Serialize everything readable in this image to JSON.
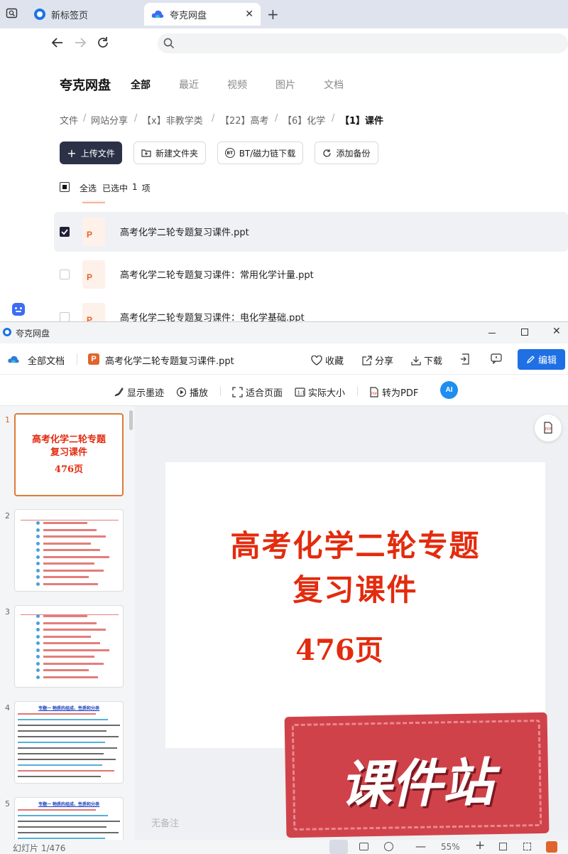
{
  "browser": {
    "tabs": [
      {
        "label": "新标签页"
      },
      {
        "label": "夸克网盘"
      }
    ]
  },
  "cloud": {
    "app_title": "夸克网盘",
    "menu": [
      "全部",
      "最近",
      "视频",
      "图片",
      "文档"
    ],
    "breadcrumb": [
      "文件",
      "网站分享",
      "【x】非教学类",
      "【22】高考",
      "【6】化学",
      "【1】课件"
    ],
    "buttons": {
      "upload": "上传文件",
      "new_folder": "新建文件夹",
      "bt": "BT/磁力链下载",
      "backup": "添加备份"
    },
    "select_all": "全选",
    "selected_text": "已选中",
    "selected_count": "1",
    "selected_unit": "项",
    "files": [
      {
        "name": "高考化学二轮专题复习课件.ppt",
        "checked": true
      },
      {
        "name": "高考化学二轮专题复习课件：常用化学计量.ppt",
        "checked": false
      },
      {
        "name": "高考化学二轮专题复习课件：电化学基础.ppt",
        "checked": false
      }
    ]
  },
  "viewer": {
    "window_title": "夸克网盘",
    "all_docs": "全部文档",
    "doc_title": "高考化学二轮专题复习课件.ppt",
    "actions": {
      "favorite": "收藏",
      "share": "分享",
      "download": "下载",
      "edit": "编辑"
    },
    "toolbar": {
      "show_ink": "显示墨迹",
      "play": "播放",
      "fit_page": "适合页面",
      "actual_size": "实际大小",
      "to_pdf": "转为PDF"
    },
    "slide": {
      "title_line1": "高考化学二轮专题",
      "title_line2": "复习课件",
      "pages": "476页"
    },
    "thumbs": [
      {
        "num": "1",
        "title1": "高考化学二轮专题",
        "title2": "复习课件",
        "pages": "476页"
      },
      {
        "num": "2"
      },
      {
        "num": "3"
      },
      {
        "num": "4",
        "header": "专题一 物质的组成、性质和分类"
      },
      {
        "num": "5",
        "header": "专题一 物质的组成、性质和分类"
      }
    ],
    "notes_placeholder": "无备注",
    "watermark": "课件站",
    "status": {
      "slide_counter": "幻灯片 1/476",
      "zoom": "55%"
    }
  }
}
